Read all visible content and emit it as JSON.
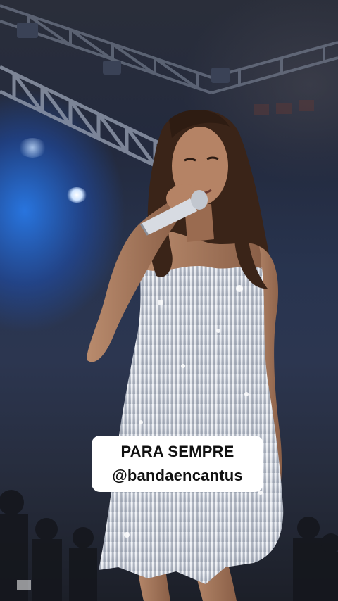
{
  "story": {
    "caption": {
      "line1": "PARA SEMPRE",
      "line2": "@bandaencantus"
    },
    "scene_icons": [
      "stage-truss-icon",
      "spotlight-icon",
      "microphone-icon",
      "singer-figure",
      "crowd-silhouette"
    ],
    "colors": {
      "stage_light_blue": "#2878e6",
      "background_dark": "#1a2235",
      "dress_silver": "#d9dde4",
      "caption_background": "#ffffff",
      "caption_text": "#111111"
    }
  }
}
